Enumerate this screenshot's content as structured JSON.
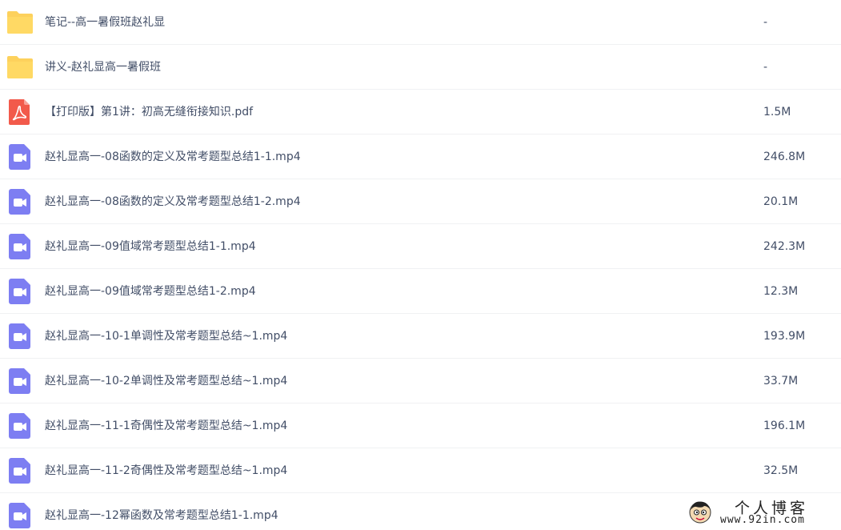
{
  "files": [
    {
      "name": "笔记--高一暑假班赵礼显",
      "size": "-",
      "icon": "folder-icon"
    },
    {
      "name": "讲义-赵礼显高一暑假班",
      "size": "-",
      "icon": "folder-icon"
    },
    {
      "name": "【打印版】第1讲：初高无缝衔接知识.pdf",
      "size": "1.5M",
      "icon": "pdf-icon"
    },
    {
      "name": "赵礼显高一-08函数的定义及常考题型总结1-1.mp4",
      "size": "246.8M",
      "icon": "video-icon"
    },
    {
      "name": "赵礼显高一-08函数的定义及常考题型总结1-2.mp4",
      "size": "20.1M",
      "icon": "video-icon"
    },
    {
      "name": "赵礼显高一-09值域常考题型总结1-1.mp4",
      "size": "242.3M",
      "icon": "video-icon"
    },
    {
      "name": "赵礼显高一-09值域常考题型总结1-2.mp4",
      "size": "12.3M",
      "icon": "video-icon"
    },
    {
      "name": "赵礼显高一-10-1单调性及常考题型总结~1.mp4",
      "size": "193.9M",
      "icon": "video-icon"
    },
    {
      "name": "赵礼显高一-10-2单调性及常考题型总结~1.mp4",
      "size": "33.7M",
      "icon": "video-icon"
    },
    {
      "name": "赵礼显高一-11-1奇偶性及常考题型总结~1.mp4",
      "size": "196.1M",
      "icon": "video-icon"
    },
    {
      "name": "赵礼显高一-11-2奇偶性及常考题型总结~1.mp4",
      "size": "32.5M",
      "icon": "video-icon"
    },
    {
      "name": "赵礼显高一-12幂函数及常考题型总结1-1.mp4",
      "size": "",
      "icon": "video-icon"
    }
  ],
  "watermark": {
    "title": "个人博客",
    "url": "www.92in.com"
  },
  "colors": {
    "text": "#424e67",
    "folder": "#fdd15c",
    "pdf": "#f25a4b",
    "video": "#7d7ef2",
    "row_divider": "#f0f1f3"
  }
}
